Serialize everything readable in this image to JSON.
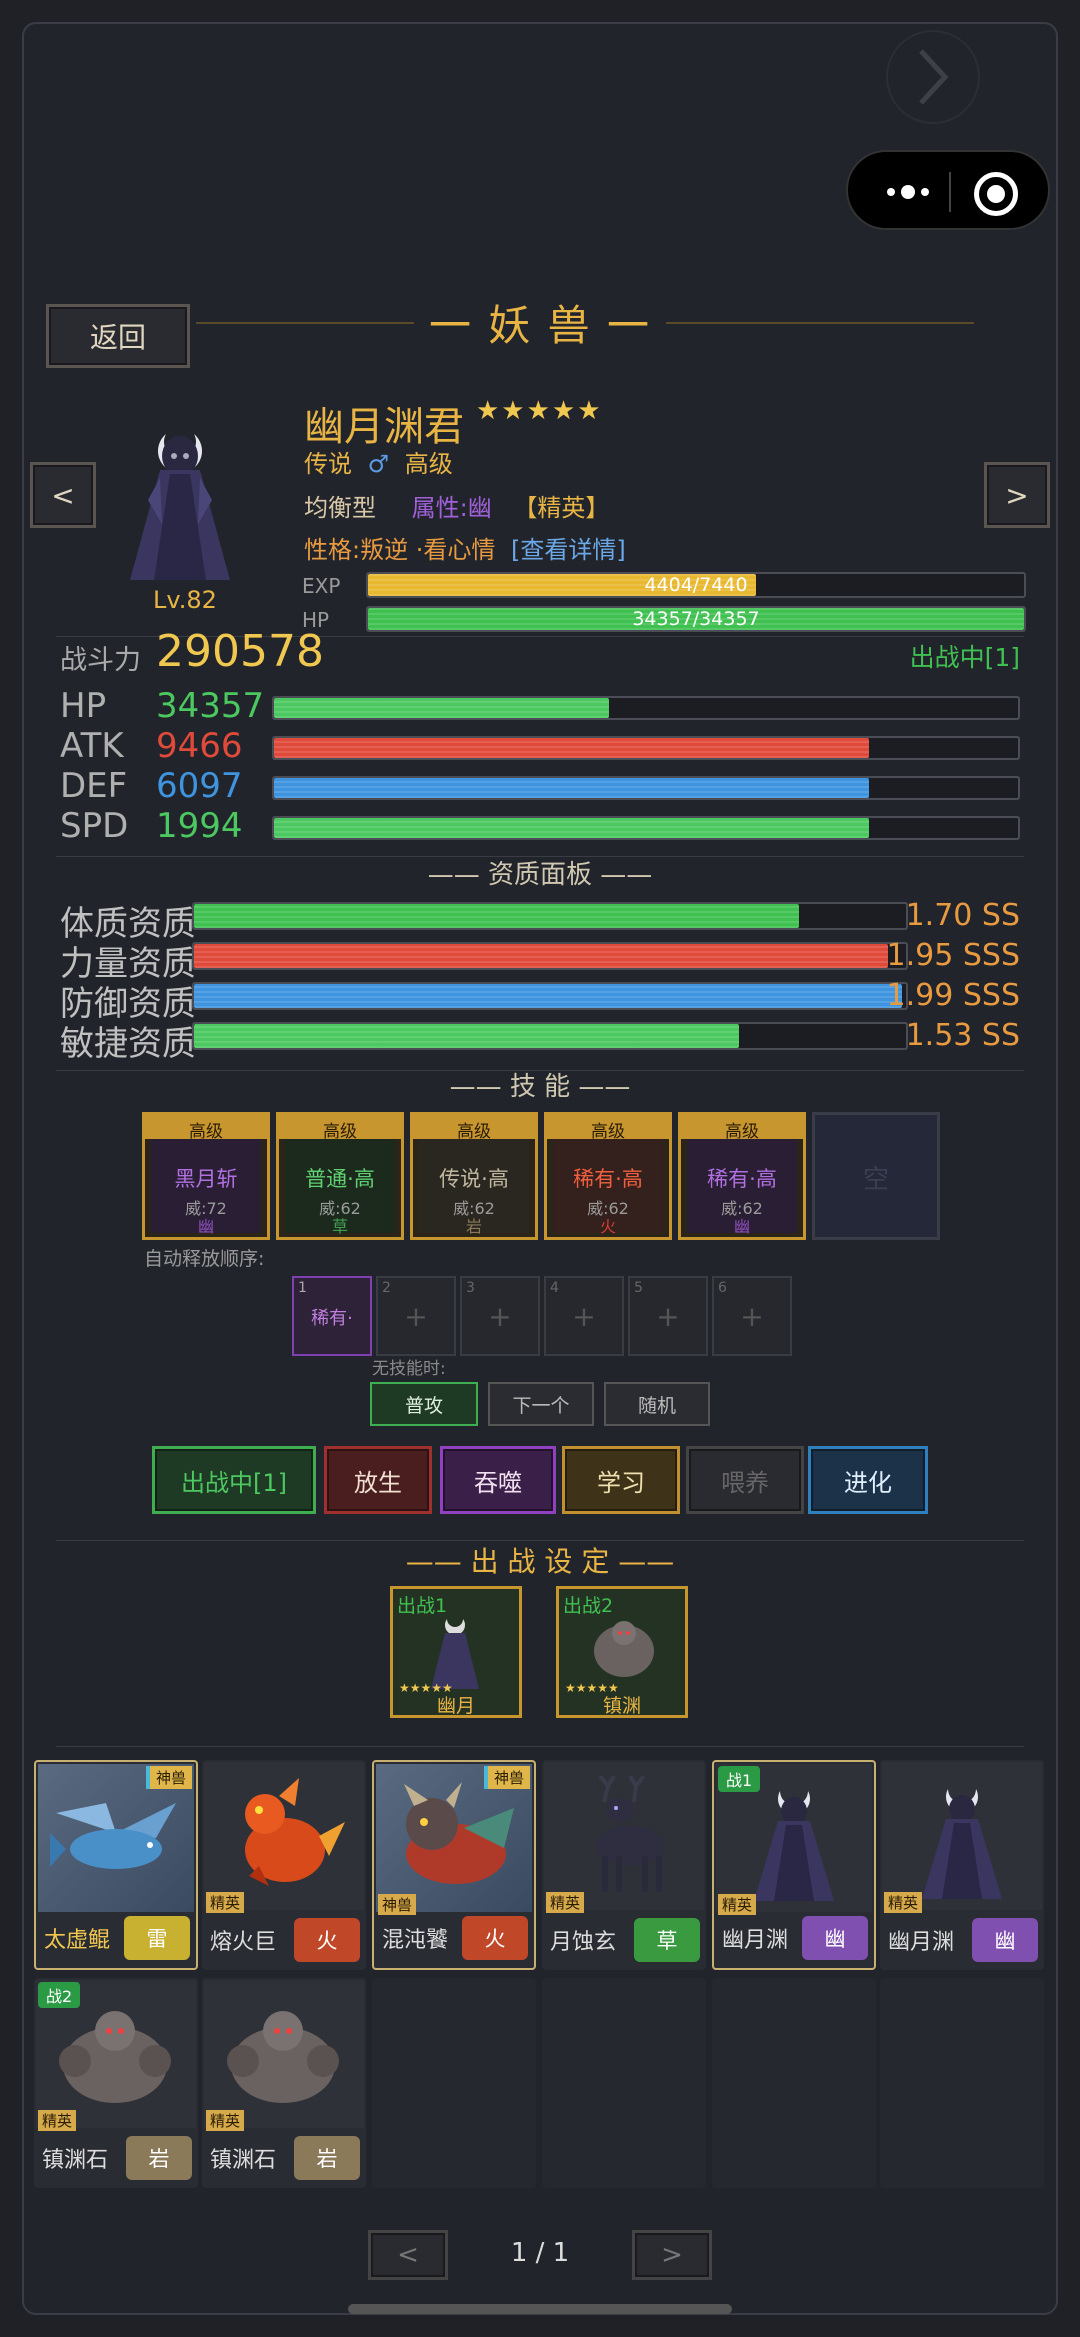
{
  "topbar": {
    "forward_icon": "chevron-right-icon",
    "menu_icon": "more-dots-icon",
    "target_icon": "target-circle-icon"
  },
  "header": {
    "back_label": "返回",
    "title": "一 妖 兽 一"
  },
  "pet": {
    "name": "幽月渊君",
    "stars": "★★★★★",
    "rarity": "传说",
    "gender_symbol": "♂",
    "grade": "高级",
    "type": "均衡型",
    "attribute": "属性:幽",
    "elite": "【精英】",
    "personality": "性格:叛逆 ·看心情",
    "details_link": "[查看详情]",
    "level": "Lv.82",
    "exp_label": "EXP",
    "exp_text": "4404/7440",
    "exp_fraction": 0.592,
    "hp_label": "HP",
    "hp_text": "34357/34357",
    "hp_fraction": 1.0,
    "prev_label": "<",
    "next_label": ">"
  },
  "power": {
    "label": "战斗力",
    "value": "290578",
    "status": "出战中[1]"
  },
  "stats": [
    {
      "label": "HP",
      "value": "34357",
      "color": "#4cc860",
      "fraction": 0.45
    },
    {
      "label": "ATK",
      "value": "9466",
      "color": "#e04a3a",
      "fraction": 0.8
    },
    {
      "label": "DEF",
      "value": "6097",
      "color": "#3f94e0",
      "fraction": 0.8
    },
    {
      "label": "SPD",
      "value": "1994",
      "color": "#4cc860",
      "fraction": 0.8
    }
  ],
  "aptitude": {
    "title": "—— 资质面板 ——",
    "rows": [
      {
        "label": "体质资质",
        "value": "1.70 SS",
        "color": "#3fc050",
        "fraction": 0.85
      },
      {
        "label": "力量资质",
        "value": "1.95 SSS",
        "color": "#e04a3a",
        "fraction": 0.975
      },
      {
        "label": "防御资质",
        "value": "1.99 SSS",
        "color": "#3f94e0",
        "fraction": 0.995
      },
      {
        "label": "敏捷资质",
        "value": "1.53 SS",
        "color": "#4cc860",
        "fraction": 0.765
      }
    ]
  },
  "skills": {
    "title": "—— 技 能 ——",
    "items": [
      {
        "grade": "高级",
        "name": "黑月斩",
        "power": "威:72",
        "element": "幽",
        "name_color": "#b070e0",
        "el_color": "#9050c0",
        "bg": "#2a1e34"
      },
      {
        "grade": "高级",
        "name": "普通·高",
        "power": "威:62",
        "element": "草",
        "name_color": "#60d070",
        "el_color": "#40a050",
        "bg": "#1c2a1e"
      },
      {
        "grade": "高级",
        "name": "传说·高",
        "power": "威:62",
        "element": "岩",
        "name_color": "#c0b8a0",
        "el_color": "#8a7a5a",
        "bg": "#2a2620"
      },
      {
        "grade": "高级",
        "name": "稀有·高",
        "power": "威:62",
        "element": "火",
        "name_color": "#f06040",
        "el_color": "#d04030",
        "bg": "#34201c"
      },
      {
        "grade": "高级",
        "name": "稀有·高",
        "power": "威:62",
        "element": "幽",
        "name_color": "#b070e0",
        "el_color": "#9050c0",
        "bg": "#2a1e34"
      }
    ],
    "empty_label": "空",
    "auto_order_label": "自动释放顺序:",
    "order_slots": [
      {
        "num": "1",
        "text": "稀有·"
      },
      {
        "num": "2",
        "text": "+"
      },
      {
        "num": "3",
        "text": "+"
      },
      {
        "num": "4",
        "text": "+"
      },
      {
        "num": "5",
        "text": "+"
      },
      {
        "num": "6",
        "text": "+"
      }
    ],
    "no_skill_label": "无技能时:",
    "fallback_options": [
      "普攻",
      "下一个",
      "随机"
    ]
  },
  "actions": [
    {
      "label": "出战中[1]",
      "color": "#4cc860",
      "border": "#3fae50",
      "bg": "#1e3a24"
    },
    {
      "label": "放生",
      "color": "#f0e0d0",
      "border": "#a03030",
      "bg": "#4a1e1e"
    },
    {
      "label": "吞噬",
      "color": "#f0e0f0",
      "border": "#9040c0",
      "bg": "#3a2048"
    },
    {
      "label": "学习",
      "color": "#f0e0b0",
      "border": "#c09030",
      "bg": "#3e3218"
    },
    {
      "label": "喂养",
      "color": "#666666",
      "border": "#444444",
      "bg": "#2a2b30"
    },
    {
      "label": "进化",
      "color": "#e0f0ff",
      "border": "#3080c0",
      "bg": "#1c3248"
    }
  ],
  "battle": {
    "title": "—— 出 战 设 定 ——",
    "slots": [
      {
        "tag": "出战1",
        "stars": "★★★★★",
        "name": "幽月"
      },
      {
        "tag": "出战2",
        "stars": "★★★★★",
        "name": "镇渊"
      }
    ]
  },
  "roster": [
    {
      "name": "太虚鲲",
      "element": "雷",
      "el_bg": "#c8b030",
      "badge_tr": "神兽",
      "sprite": "fish",
      "selected": true
    },
    {
      "name": "熔火巨",
      "element": "火",
      "el_bg": "#c04828",
      "badge_bl": "精英",
      "sprite": "dragon"
    },
    {
      "name": "混沌饕",
      "element": "火",
      "el_bg": "#c04828",
      "badge_tr": "神兽",
      "badge_bl": "神兽",
      "sprite": "beast",
      "selected": true
    },
    {
      "name": "月蚀玄",
      "element": "草",
      "el_bg": "#3a9a40",
      "badge_bl": "精英",
      "sprite": "deer"
    },
    {
      "name": "幽月渊",
      "element": "幽",
      "el_bg": "#8050b0",
      "badge_tl": "战1",
      "badge_bl": "精英",
      "sprite": "cloak",
      "selected": true
    },
    {
      "name": "幽月渊",
      "element": "幽",
      "el_bg": "#8050b0",
      "badge_bl": "精英",
      "sprite": "cloak"
    },
    {
      "name": "镇渊石",
      "element": "岩",
      "el_bg": "#8a7a5a",
      "badge_tl": "战2",
      "badge_bl": "精英",
      "sprite": "golem"
    },
    {
      "name": "镇渊石",
      "element": "岩",
      "el_bg": "#8a7a5a",
      "badge_bl": "精英",
      "sprite": "golem"
    }
  ],
  "pagination": {
    "prev": "<",
    "page": "1 / 1",
    "next": ">"
  }
}
